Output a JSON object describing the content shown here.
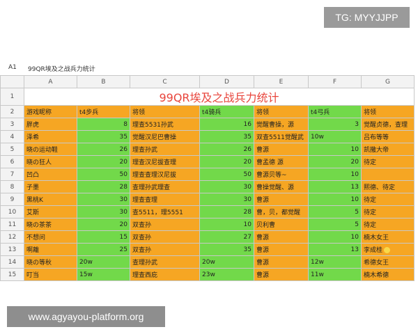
{
  "badge": "TG: MYYJJPP",
  "watermark": "www.agyayou-platform.org",
  "formula_bar": {
    "cell_ref": "A1",
    "content": "99QR埃及之战兵力统计"
  },
  "columns": [
    "A",
    "B",
    "C",
    "D",
    "E",
    "F",
    "G"
  ],
  "title": "99QR埃及之战兵力统计",
  "header_row": [
    "游戏昵称",
    "t4步兵",
    "将领",
    "t4骑兵",
    "将领",
    "t4弓兵",
    "将领"
  ],
  "rows": [
    [
      "胖虎",
      "8",
      "理查5531孙武",
      "16",
      "觉醒曹操，源",
      "3",
      "觉醒贞德，查理"
    ],
    [
      "泽希",
      "35",
      "觉醒汉尼巴曹操",
      "35",
      "双查5511觉醒武",
      "10w",
      "吕布等等"
    ],
    [
      "晓の运动鞋",
      "26",
      "理查孙武",
      "26",
      "曹源",
      "10",
      "凯撒大帝"
    ],
    [
      "晓の狂人",
      "20",
      "理查汉尼拔查理",
      "20",
      "曹孟德 源",
      "20",
      "待定"
    ],
    [
      "凹凸",
      "50",
      "理查查理汉尼拔",
      "50",
      "曹源贝等~",
      "10",
      ""
    ],
    [
      "子墨",
      "28",
      "查理孙武理查",
      "30",
      "曹操觉醒、源",
      "13",
      "熙德、待定"
    ],
    [
      "黑桃K",
      "30",
      "理查查理",
      "30",
      "曹源",
      "10",
      "待定"
    ],
    [
      "艾斯",
      "30",
      "查5511，理5551",
      "28",
      "曹，贝，都觉醒",
      "5",
      "待定"
    ],
    [
      "晓の茶茶",
      "20",
      "双查孙",
      "10",
      "贝利曹",
      "5",
      "待定"
    ],
    [
      "不想问",
      "15",
      "双查孙",
      "27",
      "曹源",
      "10",
      "楠木女王"
    ],
    [
      "啊離",
      "25",
      "双查孙",
      "35",
      "曹源",
      "13",
      "李成桂"
    ],
    [
      "晓の等秋",
      "20w",
      "查理孙武",
      "20w",
      "曹源",
      "12w",
      "希德女王"
    ],
    [
      "叮当",
      "15w",
      "理查西庇",
      "23w",
      "曹源",
      "11w",
      "楠木希德"
    ]
  ],
  "colors": {
    "orange": "#f6a623",
    "green": "#72d94a",
    "title_red": "#e8453c",
    "selection_blue": "#4a86e8"
  }
}
